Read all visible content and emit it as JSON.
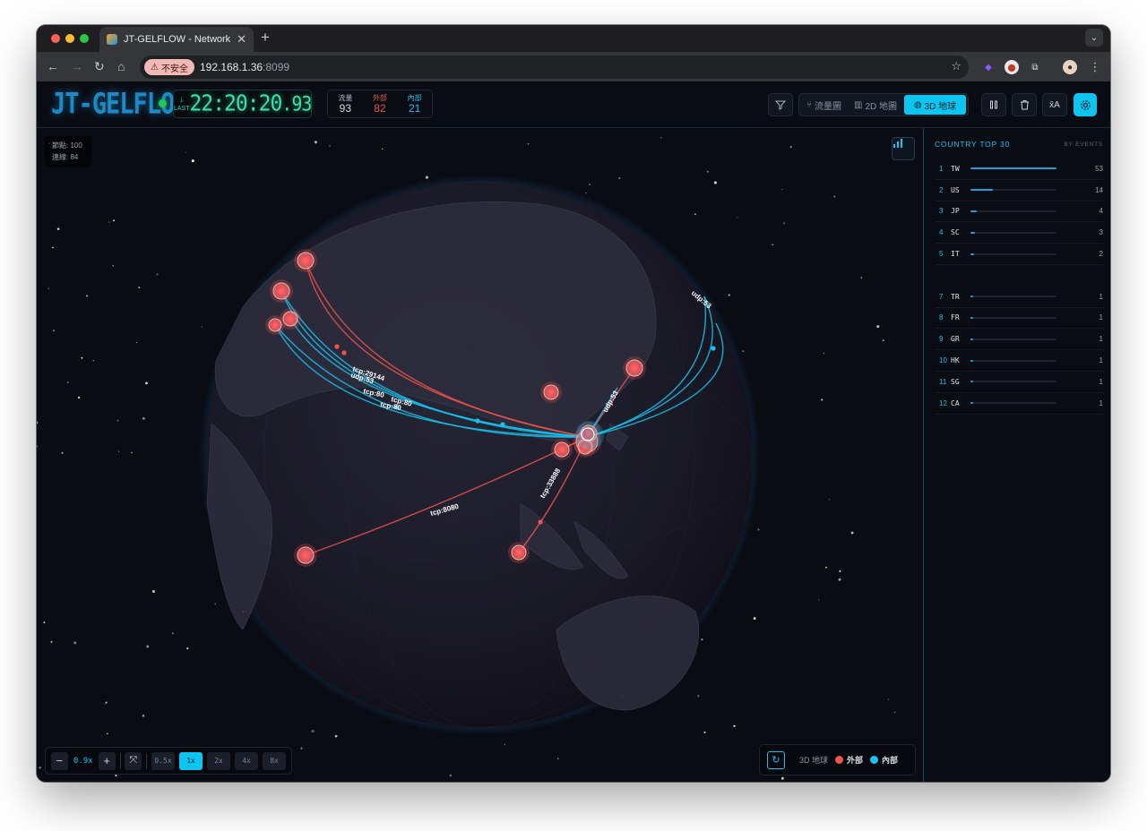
{
  "browser": {
    "tab_title": "JT-GELFLOW - Network Traffic",
    "insecure_label": "不安全",
    "url_host": "192.168.1.36",
    "url_port": ":8099"
  },
  "header": {
    "logo": "JT-GELFLOW",
    "last_label": "LAST",
    "clock_time": "22:20:20",
    "clock_ms": ".93",
    "stats": [
      {
        "label": "流量",
        "value": "93",
        "color": "#d6dbe2"
      },
      {
        "label": "外部",
        "value": "82",
        "color": "#ef5350"
      },
      {
        "label": "內部",
        "value": "21",
        "color": "#17c3f0"
      }
    ],
    "views": [
      {
        "label": "流量圖",
        "icon": "flow-graph-icon",
        "active": false
      },
      {
        "label": "2D 地圖",
        "icon": "map-2d-icon",
        "active": false
      },
      {
        "label": "3D 地球",
        "icon": "globe-icon",
        "active": true
      }
    ]
  },
  "map": {
    "nodes_label": "節點: 100",
    "edges_label": "連線: 84",
    "zoom_value": "0.9x",
    "speeds": [
      {
        "label": "0.5x",
        "active": false
      },
      {
        "label": "1x",
        "active": true
      },
      {
        "label": "2x",
        "active": false
      },
      {
        "label": "4x",
        "active": false
      },
      {
        "label": "8x",
        "active": false
      }
    ],
    "legend_view": "3D 地球",
    "legend_external": "外部",
    "legend_internal": "內部",
    "arc_labels": [
      "tcp:29144",
      "udp:53",
      "tcp:80",
      "tcp:80",
      "tcp:80",
      "tcp:8080",
      "tcp:33888",
      "udp:53",
      "udp:53"
    ]
  },
  "panel": {
    "title": "COUNTRY TOP 30",
    "subtitle": "BY EVENTS",
    "rows": [
      {
        "rank": "1",
        "code": "TW",
        "count": 53
      },
      {
        "rank": "2",
        "code": "US",
        "count": 14
      },
      {
        "rank": "3",
        "code": "JP",
        "count": 4
      },
      {
        "rank": "4",
        "code": "SC",
        "count": 3
      },
      {
        "rank": "5",
        "code": "IT",
        "count": 2
      },
      {
        "rank": "",
        "code": "",
        "count": null
      },
      {
        "rank": "7",
        "code": "TR",
        "count": 1
      },
      {
        "rank": "8",
        "code": "FR",
        "count": 1
      },
      {
        "rank": "9",
        "code": "GR",
        "count": 1
      },
      {
        "rank": "10",
        "code": "HK",
        "count": 1
      },
      {
        "rank": "11",
        "code": "SG",
        "count": 1
      },
      {
        "rank": "12",
        "code": "CA",
        "count": 1
      }
    ]
  }
}
